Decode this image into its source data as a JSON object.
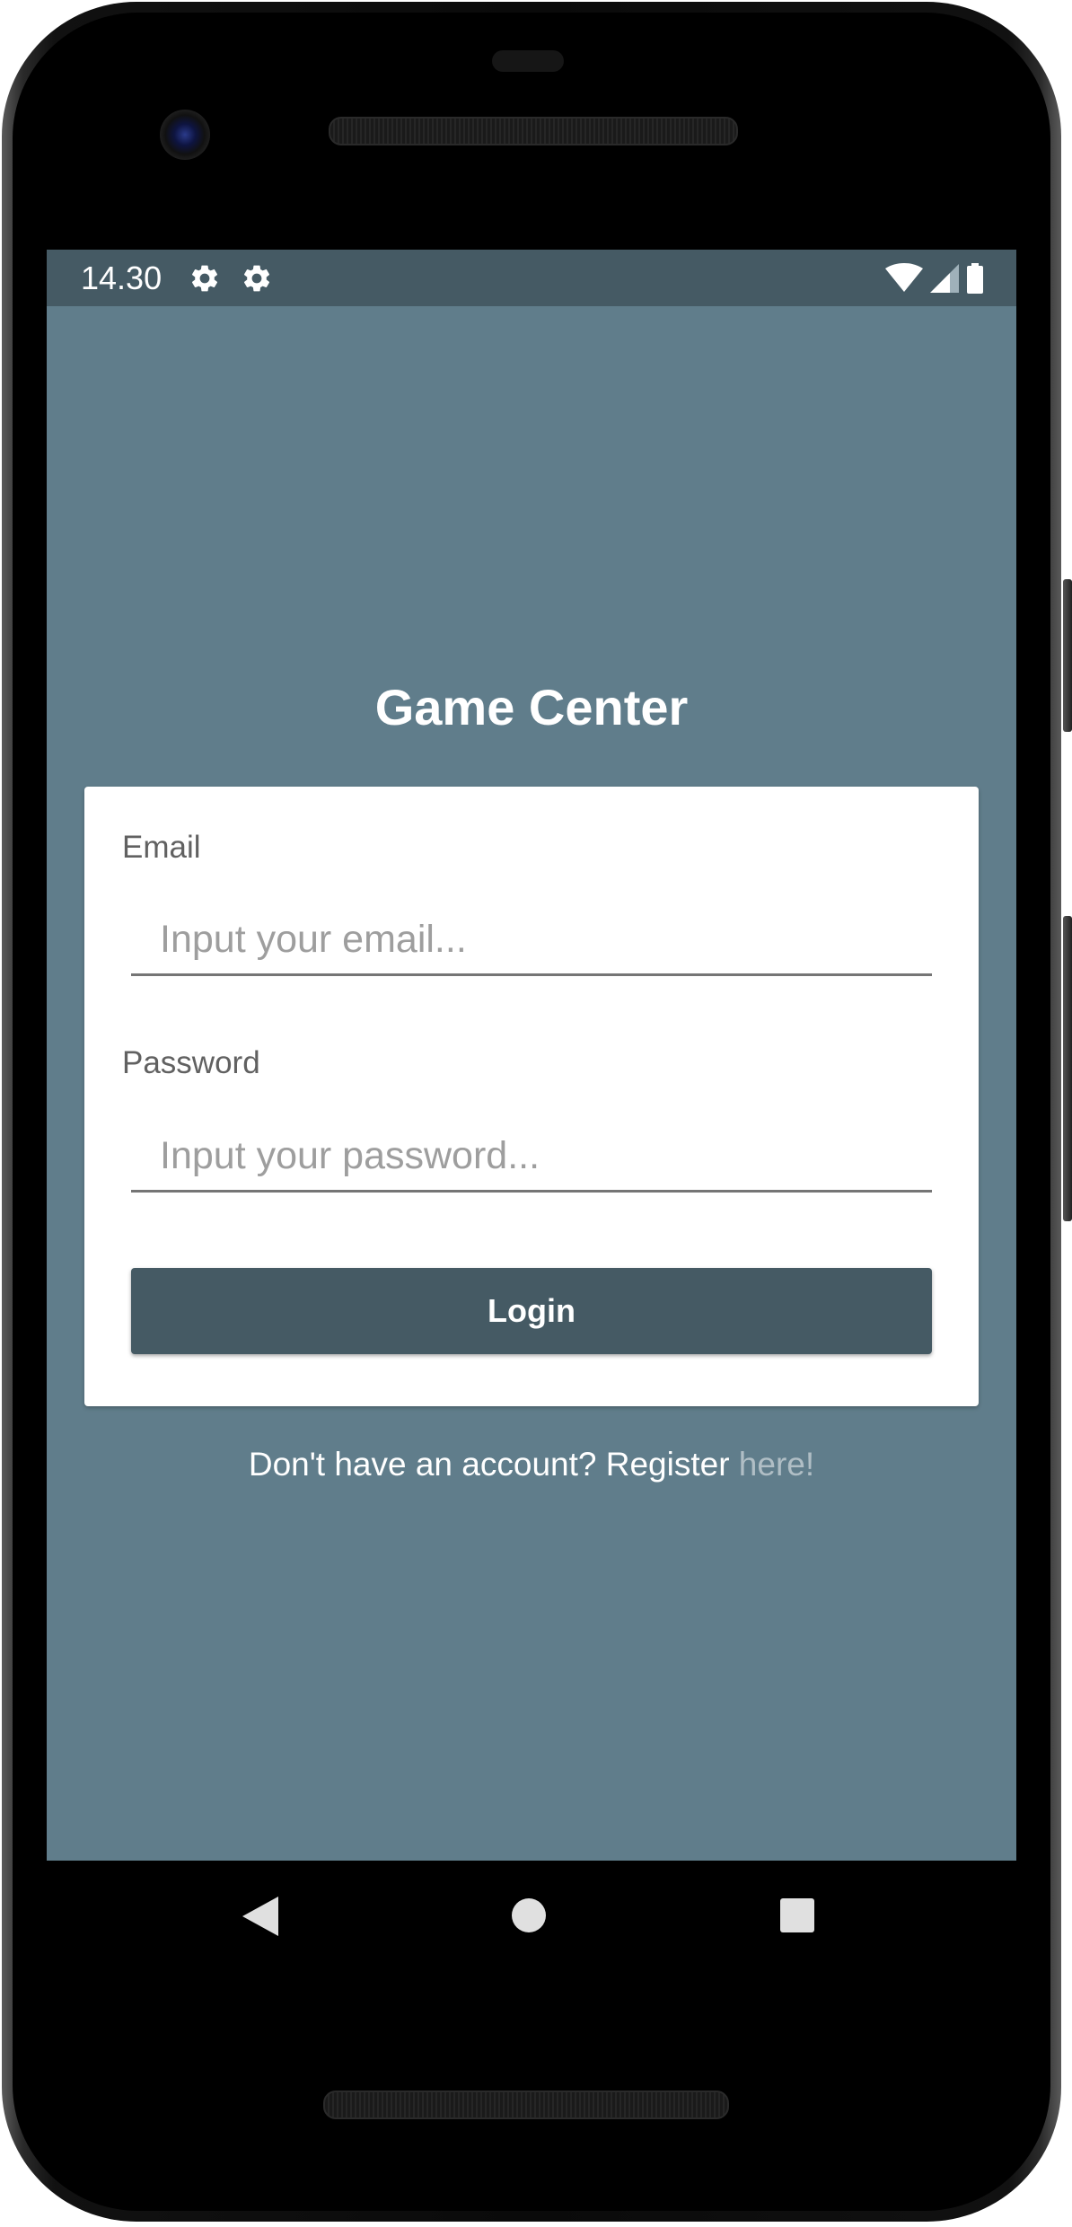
{
  "status_bar": {
    "time": "14.30",
    "icons": [
      "gear-icon",
      "gear-icon",
      "wifi-icon",
      "signal-icon",
      "battery-icon"
    ]
  },
  "app": {
    "title": "Game Center"
  },
  "login_form": {
    "email_label": "Email",
    "email_placeholder": "Input your email...",
    "email_value": "",
    "password_label": "Password",
    "password_placeholder": "Input your password...",
    "password_value": "",
    "login_label": "Login"
  },
  "register": {
    "prompt": "Don't have an account? Register ",
    "link_label": "here!"
  },
  "nav_bar": {
    "icons": [
      "back-icon",
      "home-icon",
      "recents-icon"
    ]
  },
  "colors": {
    "background": "#607d8b",
    "status_bar": "#455a64",
    "button": "#455a64",
    "card": "#ffffff",
    "link": "#b0bec5"
  }
}
